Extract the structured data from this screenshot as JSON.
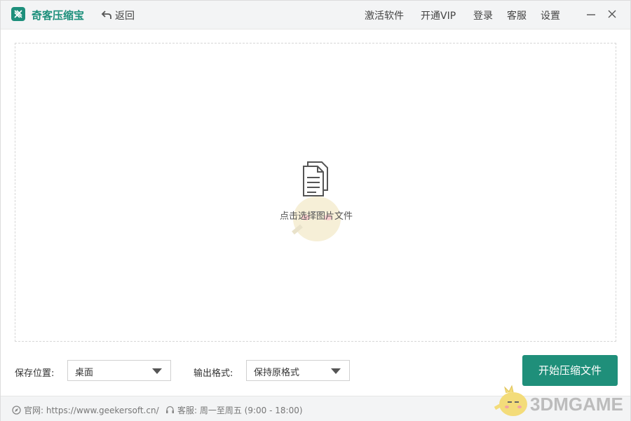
{
  "titlebar": {
    "app_name": "奇客压缩宝",
    "back_label": "返回",
    "nav": [
      "激活软件",
      "开通VIP",
      "登录",
      "客服",
      "设置"
    ],
    "accent_color": "#1d8f7b"
  },
  "dropzone": {
    "hint": "点击选择图片文件",
    "icon": "document-icon"
  },
  "controls": {
    "save_location_label": "保存位置:",
    "save_location_value": "桌面",
    "output_format_label": "输出格式:",
    "output_format_value": "保持原格式",
    "start_button": "开始压缩文件",
    "button_color": "#1f8f7a"
  },
  "statusbar": {
    "website": "官网: https://www.geekersoft.cn/",
    "support": "客服: 周一至周五 (9:00 - 18:00)"
  },
  "watermark": {
    "text": "3DMGAME"
  }
}
